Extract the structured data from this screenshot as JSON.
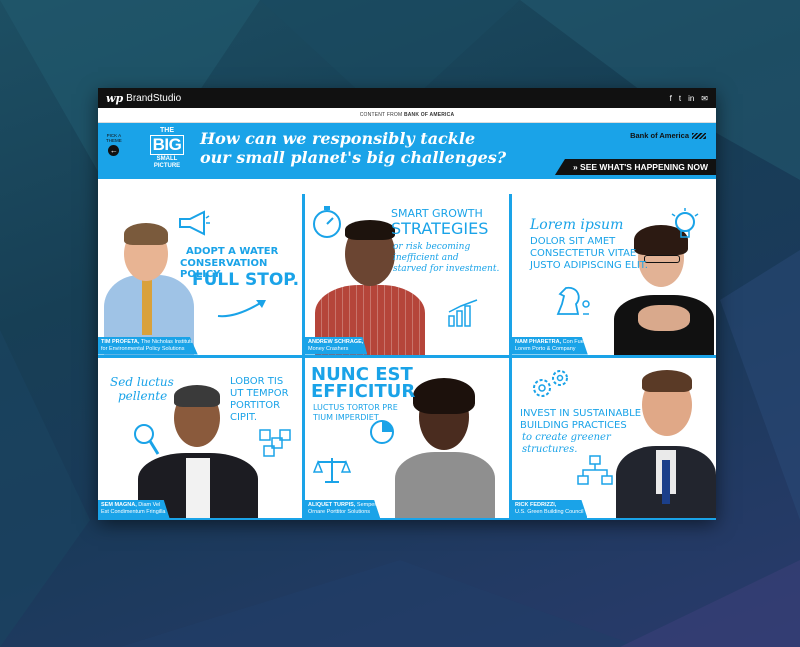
{
  "header": {
    "brand_logo": "wp",
    "brand_name": "BrandStudio",
    "social": [
      "f",
      "t",
      "in",
      "✉"
    ],
    "content_from_prefix": "CONTENT FROM ",
    "content_from_sponsor": "BANK OF AMERICA"
  },
  "banner": {
    "back_label_1": "PICK A",
    "back_label_2": "THEME",
    "logo_the": "THE",
    "logo_big": "BIG",
    "logo_small": "SMALL",
    "logo_picture": "PICTURE",
    "headline": "How can we responsibly tackle our small planet's big challenges?",
    "sponsor": "Bank of America",
    "cta": "SEE WHAT'S HAPPENING NOW"
  },
  "tiles": [
    {
      "quote_1": "ADOPT A WATER",
      "quote_2": "CONSERVATION POLICY.",
      "quote_3": "FULL STOP.",
      "name": "TIM PROFETA,",
      "org": " The Nicholas Institute",
      "org2": "for Environmental Policy Solutions",
      "icon": "megaphone-icon"
    },
    {
      "quote_1": "SMART GROWTH",
      "quote_2": "STRATEGIES",
      "quote_3": "or risk becoming",
      "quote_4": "inefficient and",
      "quote_5": "starved for investment.",
      "name": "ANDREW SCHRAGE,",
      "org": "Money Crashers",
      "icon": "stopwatch-icon"
    },
    {
      "quote_1": "Lorem ipsum",
      "quote_2": "DOLOR SIT AMET",
      "quote_3": "CONSECTETUR VITAE",
      "quote_4": "JUSTO ADIPISCING ELIT.",
      "name": "NAM PHARETRA,",
      "org": " Con Fue",
      "org2": "Lorem Porto & Company",
      "icon": "lightbulb-icon"
    },
    {
      "quote_1": "Sed luctus",
      "quote_2": "pellente",
      "quote_3": "LOBOR TIS",
      "quote_4": "UT TEMPOR",
      "quote_5": "PORTITOR",
      "quote_6": "CIPIT.",
      "name": "SEM MAGNA,",
      "org": " Diam Vel",
      "org2": "Est Condimentum Fringilla",
      "icon": "magnifier-icon"
    },
    {
      "quote_1": "NUNC EST",
      "quote_2": "EFFICITUR",
      "quote_3": "LUCTUS TORTOR PRE",
      "quote_4": "TIUM IMPERDIET",
      "name": "ALIQUET TURPIS,",
      "org": " Semper",
      "org2": "Ornare Porttitor Solutions",
      "icon": "scales-icon"
    },
    {
      "quote_1": "INVEST IN SUSTAINABLE",
      "quote_2": "BUILDING PRACTICES",
      "quote_3": "to create greener",
      "quote_4": "structures.",
      "name": "RICK FEDRIZZI,",
      "org2": "U.S. Green Building Council",
      "icon": "gears-icon"
    }
  ],
  "colors": {
    "accent": "#1aa3e8",
    "dark": "#111111"
  }
}
